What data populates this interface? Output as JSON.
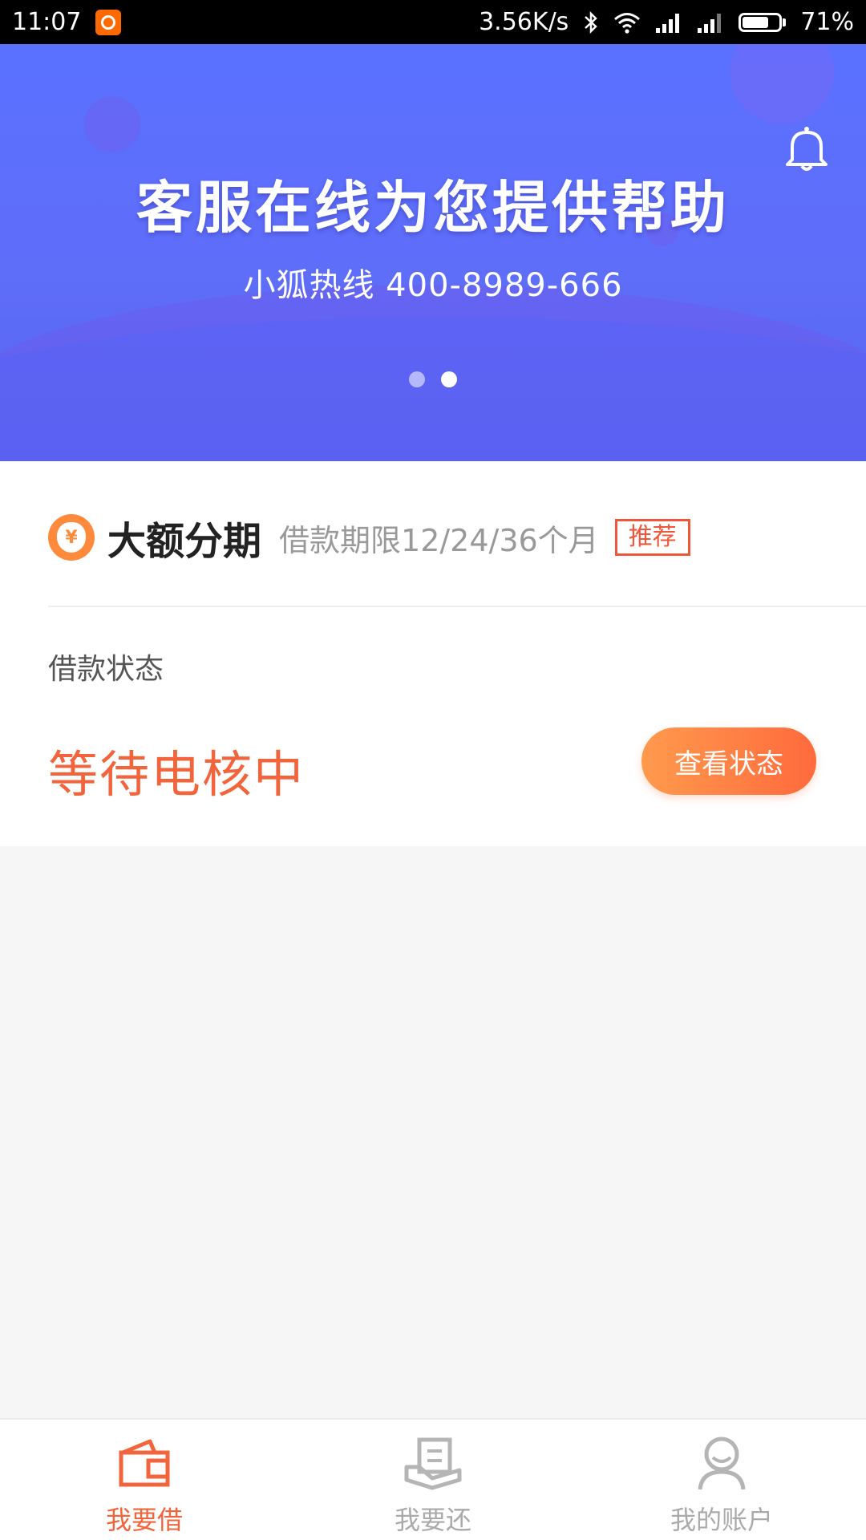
{
  "status_bar": {
    "time": "11:07",
    "network_speed": "3.56K/s",
    "battery_percent": "71%",
    "battery_level": 0.71
  },
  "banner": {
    "title": "客服在线为您提供帮助",
    "subtitle": "小狐热线 400-8989-666",
    "slide_count": 2,
    "active_slide": 2
  },
  "product": {
    "name": "大额分期",
    "term": "借款期限12/24/36个月",
    "tag": "推荐"
  },
  "loan_status": {
    "label": "借款状态",
    "value": "等待电核中",
    "button": "查看状态"
  },
  "tabs": [
    {
      "label": "我要借",
      "icon": "wallet-icon",
      "active": true
    },
    {
      "label": "我要还",
      "icon": "repay-icon",
      "active": false
    },
    {
      "label": "我的账户",
      "icon": "user-icon",
      "active": false
    }
  ],
  "colors": {
    "accent": "#f2653c",
    "banner": "#5a70ff",
    "inactive": "#aaaaaa"
  }
}
